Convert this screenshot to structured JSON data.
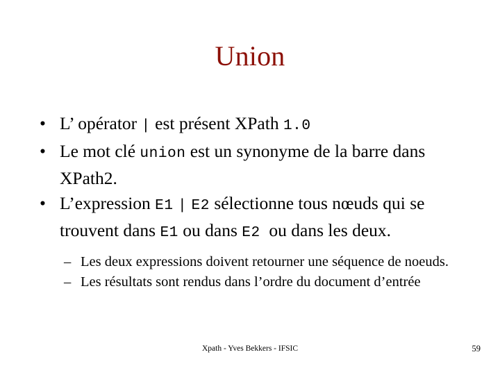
{
  "slide": {
    "title": "Union",
    "title_color": "#8C1007",
    "background_color": "#ffffff",
    "bullets": [
      {
        "marker": "•",
        "parts": [
          {
            "text": "L’ opérator ",
            "style": "normal"
          },
          {
            "text": "|",
            "style": "mono"
          },
          {
            "text": " est présent XPath ",
            "style": "normal"
          },
          {
            "text": "1.0",
            "style": "mono"
          }
        ]
      },
      {
        "marker": "•",
        "parts": [
          {
            "text": "Le mot clé ",
            "style": "normal"
          },
          {
            "text": "union",
            "style": "mono"
          },
          {
            "text": " est un synonyme de la barre dans XPath2.",
            "style": "normal"
          }
        ]
      },
      {
        "marker": "•",
        "parts": [
          {
            "text": "L’expression ",
            "style": "normal"
          },
          {
            "text": "E1",
            "style": "mono"
          },
          {
            "text": " ",
            "style": "normal"
          },
          {
            "text": "|",
            "style": "mono"
          },
          {
            "text": " ",
            "style": "normal"
          },
          {
            "text": "E2",
            "style": "mono"
          },
          {
            "text": " sélectionne tous nœuds qui se trouvent dans ",
            "style": "normal"
          },
          {
            "text": "E1",
            "style": "mono"
          },
          {
            "text": " ou dans ",
            "style": "normal"
          },
          {
            "text": "E2",
            "style": "mono"
          },
          {
            "text": "  ou dans les deux.",
            "style": "normal"
          }
        ]
      }
    ],
    "sub_bullets": [
      {
        "marker": "–",
        "parts": [
          {
            "text": "Les deux expressions doivent retourner une séquence de noeuds.",
            "style": "normal"
          }
        ]
      },
      {
        "marker": "–",
        "parts": [
          {
            "text": "Les résultats sont rendus dans l’ordre du document d’entrée",
            "style": "normal"
          }
        ]
      }
    ]
  },
  "footer": {
    "text": "Xpath - Yves Bekkers - IFSIC",
    "page_number": "59"
  }
}
